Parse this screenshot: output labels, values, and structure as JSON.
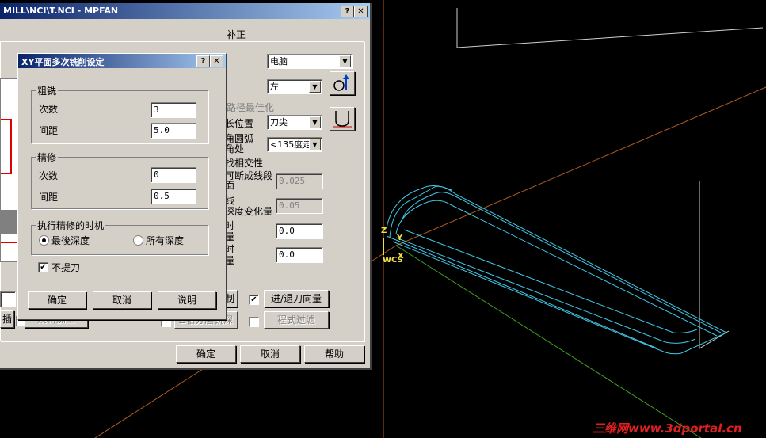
{
  "main_window": {
    "title": "MILL\\NCI\\T.NCI - MPFAN",
    "help_btn": "?",
    "close_btn": "✕",
    "top_right_label": "补正",
    "comp_type": "电脑",
    "comp_dir": "左",
    "optimize_label": "路径最佳化",
    "tip_pos_label": "长位置",
    "tip_pos_value": "刀尖",
    "arc_label_1": "角圆弧",
    "arc_label_2": "角处",
    "arc_value": "<135度走",
    "intersect_label": "找相交性",
    "break_label_1": "可断成线段",
    "break_label_2": "面",
    "break_value": "0.025",
    "depth_change_label_1": "线",
    "depth_change_label_2": "深度变化量",
    "depth_change_value": "0.05",
    "stock1_label_1": "时",
    "stock1_label_2": "量",
    "stock1_value": "0.0",
    "stock2_label_1": "时",
    "stock2_label_2": "量",
    "stock2_value": "0.0",
    "btn_partial_left": "插",
    "btn_remain": "残料加工",
    "btn_control_tail": "制",
    "btn_z_layer": "Z轴分层铣深",
    "btn_lead": "进/退刀向量",
    "btn_filter": "程式过滤",
    "ok": "确定",
    "cancel": "取消",
    "help": "帮助"
  },
  "dialog": {
    "title": "XY平面多次铣削设定",
    "rough_group": "粗铣",
    "rough_count_label": "次数",
    "rough_count_value": "3",
    "rough_step_label": "间距",
    "rough_step_value": "5.0",
    "finish_group": "精修",
    "finish_count_label": "次数",
    "finish_count_value": "0",
    "finish_step_label": "间距",
    "finish_step_value": "0.5",
    "timing_group": "执行精修的时机",
    "radio_last_depth": "最後深度",
    "radio_all_depth": "所有深度",
    "no_lift_label": "不提刀",
    "ok": "确定",
    "cancel": "取消",
    "explain": "说明"
  },
  "viewport": {
    "axis_z": "Z",
    "axis_y": "Y",
    "axis_x": "X",
    "wcs": "WCS"
  },
  "watermark": "三维网www.3dportal.cn",
  "colors": {
    "toolpath": "#40c8e8",
    "axis_orange": "#b05a20",
    "axis_green": "#40a020",
    "wire_white": "#d0d0d0",
    "axis_label": "#f0e040"
  }
}
